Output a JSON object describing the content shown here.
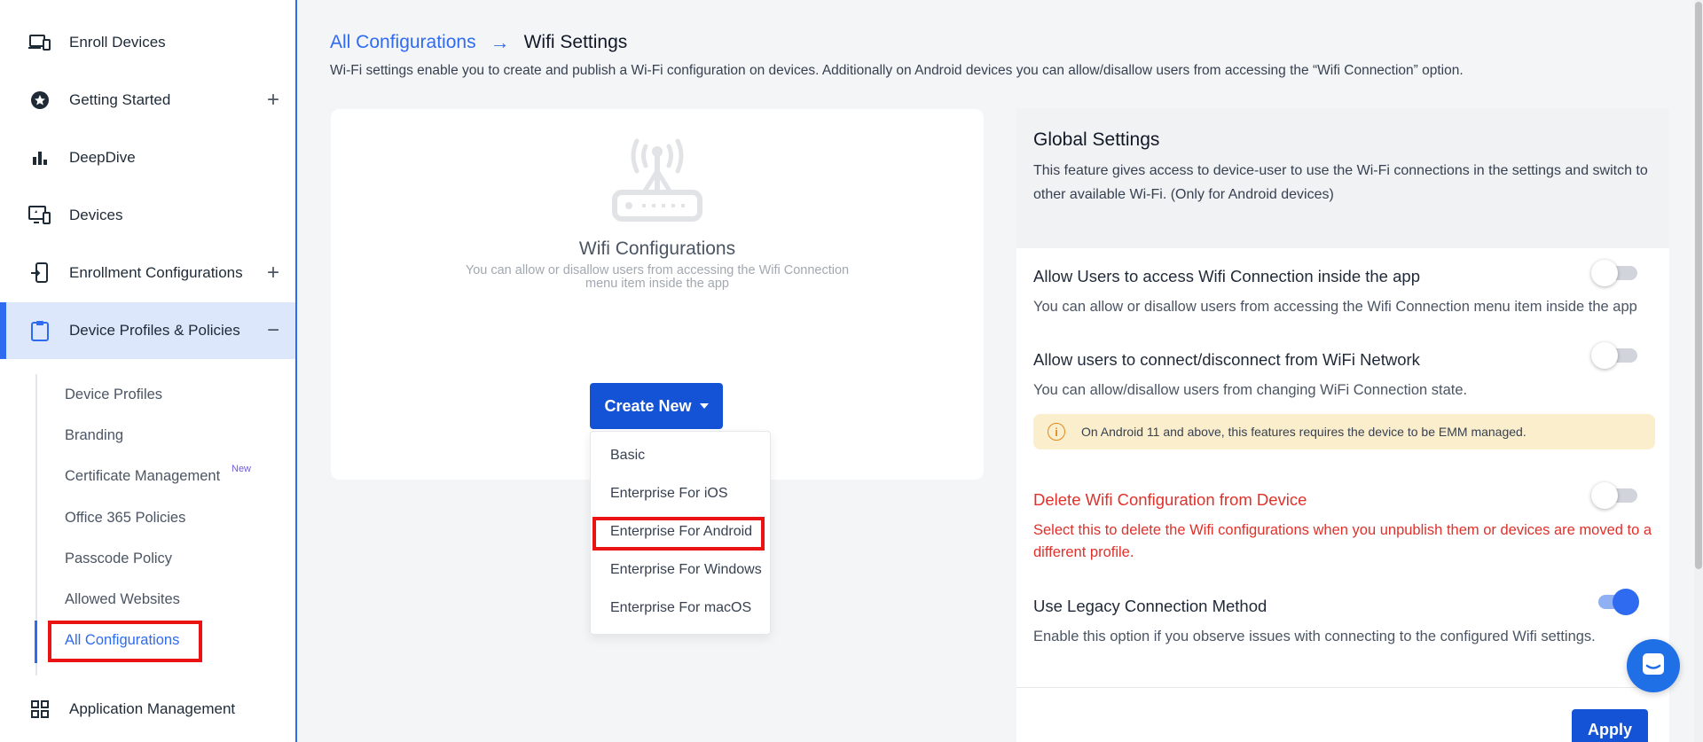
{
  "sidebar": {
    "items": [
      {
        "label": "Enroll Devices",
        "icon": "devices-icon"
      },
      {
        "label": "Getting Started",
        "icon": "star-icon",
        "expander": "+"
      },
      {
        "label": "DeepDive",
        "icon": "bar-chart-icon"
      },
      {
        "label": "Devices",
        "icon": "monitor-icon"
      },
      {
        "label": "Enrollment Configurations",
        "icon": "phone-enroll-icon",
        "expander": "+"
      },
      {
        "label": "Device Profiles & Policies",
        "icon": "clipboard-icon",
        "expander": "−"
      },
      {
        "label": "Application Management",
        "icon": "grid-icon"
      }
    ],
    "subitems": [
      {
        "label": "Device Profiles"
      },
      {
        "label": "Branding"
      },
      {
        "label": "Certificate Management"
      },
      {
        "label": "Office 365 Policies"
      },
      {
        "label": "Passcode Policy"
      },
      {
        "label": "Allowed Websites"
      },
      {
        "label": "All Configurations"
      }
    ],
    "new_badge": "New"
  },
  "breadcrumb": {
    "parent": "All Configurations",
    "current": "Wifi Settings"
  },
  "page_description": "Wi-Fi settings enable you to create and publish a Wi-Fi configuration on devices. Additionally on Android devices you can allow/disallow users from accessing the “Wifi Connection” option.",
  "wifi_card": {
    "title": "Wifi Configurations",
    "subtitle": "You can allow or disallow users from accessing the Wifi Connection menu item inside the app",
    "create_button": "Create New",
    "dropdown_options": [
      "Basic",
      "Enterprise For iOS",
      "Enterprise For Android",
      "Enterprise For Windows",
      "Enterprise For macOS"
    ]
  },
  "global_settings": {
    "title": "Global Settings",
    "description": "This feature gives access to device-user to use the Wi-Fi connections in the settings and switch to other available Wi-Fi. (Only for Android devices)",
    "settings": [
      {
        "title": "Allow Users to access Wifi Connection inside the app",
        "desc": "You can allow or disallow users from accessing the Wifi Connection menu item inside the app",
        "enabled": false
      },
      {
        "title": "Allow users to connect/disconnect from WiFi Network",
        "desc": "You can allow/disallow users from changing WiFi Connection state.",
        "enabled": false
      },
      {
        "title": "Delete Wifi Configuration from Device",
        "desc": "Select this to delete the Wifi configurations when you unpublish them or devices are moved to a different profile.",
        "enabled": false
      },
      {
        "title": "Use Legacy Connection Method",
        "desc": "Enable this option if you observe issues with connecting to the configured Wifi settings.",
        "enabled": true
      }
    ],
    "note": "On Android 11 and above, this features requires the device to be EMM managed.",
    "apply_button": "Apply"
  },
  "colors": {
    "primary": "#2f6bf0",
    "button": "#1553d6",
    "danger": "#e0312b",
    "note_bg": "#fbeecd",
    "highlight_box": "#ea1313"
  }
}
